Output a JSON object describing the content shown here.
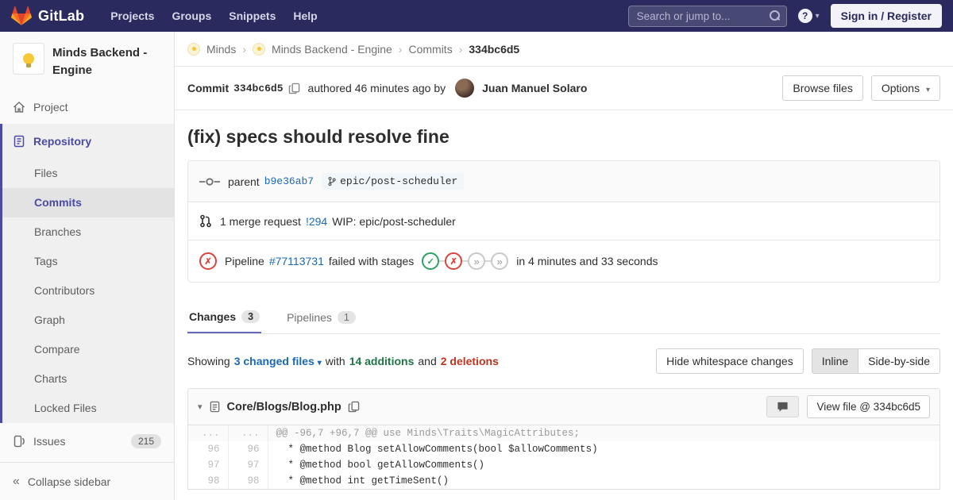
{
  "navbar": {
    "brand": "GitLab",
    "links": {
      "projects": "Projects",
      "groups": "Groups",
      "snippets": "Snippets",
      "help": "Help"
    },
    "search_placeholder": "Search or jump to...",
    "help_glyph": "?",
    "sign_in_label": "Sign in / Register"
  },
  "sidebar": {
    "project_title": "Minds Backend - Engine",
    "project_label": "Project",
    "repository_label": "Repository",
    "repo_items": [
      "Files",
      "Commits",
      "Branches",
      "Tags",
      "Contributors",
      "Graph",
      "Compare",
      "Charts",
      "Locked Files"
    ],
    "issues_label": "Issues",
    "issues_count": "215",
    "collapse_label": "Collapse sidebar"
  },
  "breadcrumb": {
    "items": [
      "Minds",
      "Minds Backend - Engine",
      "Commits"
    ],
    "current": "334bc6d5",
    "separator": "›"
  },
  "commit_header": {
    "commit_label": "Commit",
    "sha": "334bc6d5",
    "authored_text": "authored 46 minutes ago by",
    "author": "Juan Manuel Solaro",
    "browse_files_label": "Browse files",
    "options_label": "Options"
  },
  "commit": {
    "title": "(fix) specs should resolve fine",
    "parent_label": "parent",
    "parent_sha": "b9e36ab7",
    "branch": "epic/post-scheduler",
    "mr_count_text": "1 merge request",
    "mr_link": "!294",
    "mr_title": "WIP: epic/post-scheduler",
    "pipeline_label": "Pipeline",
    "pipeline_link": "#77113731",
    "pipeline_status_text": "failed with stages",
    "pipeline_duration": "in 4 minutes and 33 seconds"
  },
  "tabs": {
    "changes_label": "Changes",
    "changes_count": "3",
    "pipelines_label": "Pipelines",
    "pipelines_count": "1"
  },
  "diff_summary": {
    "showing": "Showing",
    "changed_files_link": "3 changed files",
    "with_text": "with",
    "additions": "14 additions",
    "and_text": "and",
    "deletions": "2 deletions",
    "hide_whitespace_label": "Hide whitespace changes",
    "inline_label": "Inline",
    "side_by_side_label": "Side-by-side"
  },
  "diff_file": {
    "path": "Core/Blogs/Blog.php",
    "view_file_label": "View file @ 334bc6d5",
    "rows": [
      {
        "old": "...",
        "new": "...",
        "text": "@@ -96,7 +96,7 @@ use Minds\\Traits\\MagicAttributes;"
      },
      {
        "old": "96",
        "new": "96",
        "text": "  * @method Blog setAllowComments(bool $allowComments)"
      },
      {
        "old": "97",
        "new": "97",
        "text": "  * @method bool getAllowComments()"
      },
      {
        "old": "98",
        "new": "98",
        "text": "  * @method int getTimeSent()"
      }
    ]
  },
  "icons": {
    "caret_down": "▾",
    "collapse": "«",
    "skipped": "»",
    "check": "✓",
    "cross": "✗"
  },
  "colors": {
    "navbar": "#2a2a5e",
    "accent_indigo": "#4b4ba3",
    "link_blue": "#1b69b6",
    "success_green": "#2da160",
    "danger_red": "#db3b21"
  }
}
